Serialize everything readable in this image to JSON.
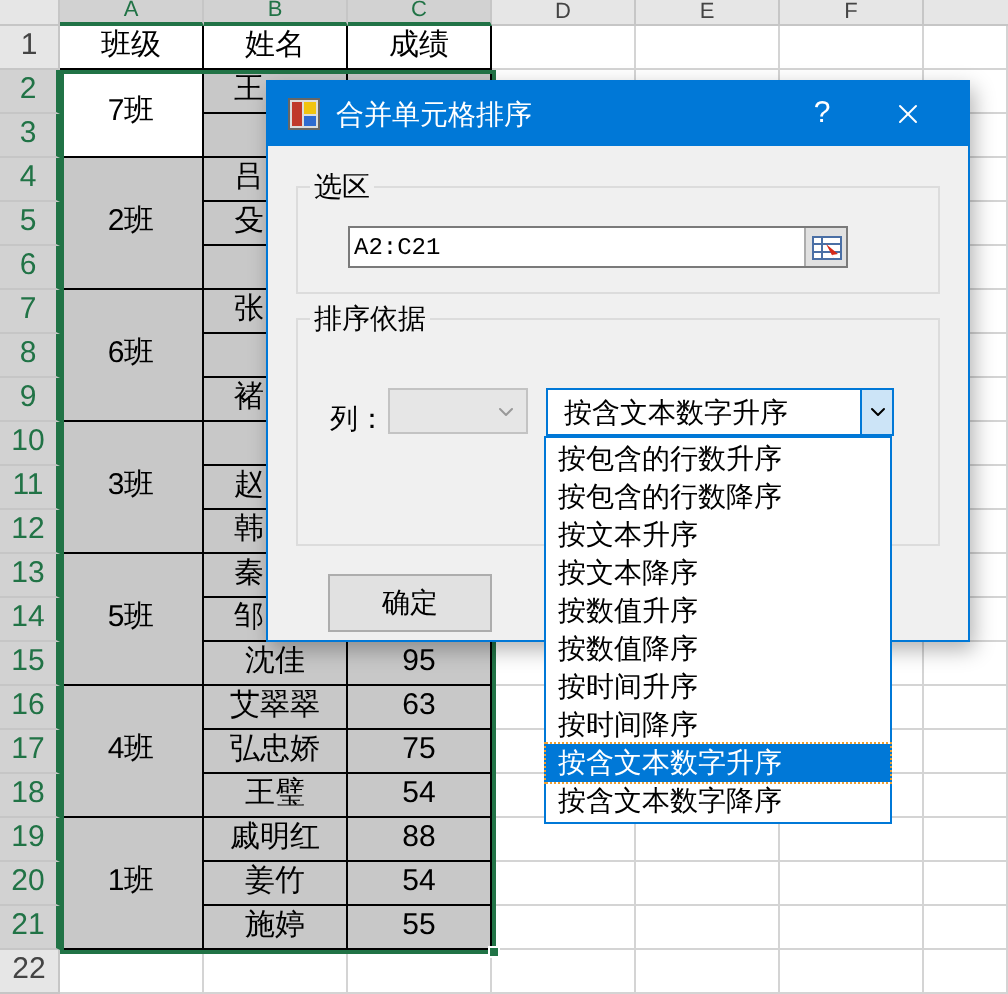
{
  "sheet": {
    "columns": [
      {
        "label": "A",
        "selected": true
      },
      {
        "label": "B",
        "selected": true
      },
      {
        "label": "C",
        "selected": true
      },
      {
        "label": "D",
        "selected": false
      },
      {
        "label": "E",
        "selected": false
      },
      {
        "label": "F",
        "selected": false
      }
    ],
    "rows": [
      {
        "label": "1",
        "selected": false,
        "kind": "header",
        "cells": [
          "班级",
          "姓名",
          "成绩"
        ]
      },
      {
        "label": "2",
        "selected": true,
        "kind": "data",
        "class": "7班",
        "shaded": false,
        "name": "王"
      },
      {
        "label": "3",
        "selected": true,
        "kind": "data"
      },
      {
        "label": "4",
        "selected": true,
        "kind": "data",
        "class": "2班",
        "shaded": true,
        "name": "吕"
      },
      {
        "label": "5",
        "selected": true,
        "kind": "data",
        "name": "殳"
      },
      {
        "label": "6",
        "selected": true,
        "kind": "data"
      },
      {
        "label": "7",
        "selected": true,
        "kind": "data",
        "class": "6班",
        "shaded": true,
        "name": "张"
      },
      {
        "label": "8",
        "selected": true,
        "kind": "data"
      },
      {
        "label": "9",
        "selected": true,
        "kind": "data",
        "name": "褚"
      },
      {
        "label": "10",
        "selected": true,
        "kind": "data",
        "class": "3班",
        "shaded": true
      },
      {
        "label": "11",
        "selected": true,
        "kind": "data",
        "name": "赵"
      },
      {
        "label": "12",
        "selected": true,
        "kind": "data",
        "name": "韩"
      },
      {
        "label": "13",
        "selected": true,
        "kind": "data",
        "class": "5班",
        "shaded": true,
        "name": "秦"
      },
      {
        "label": "14",
        "selected": true,
        "kind": "data",
        "name": "邹"
      },
      {
        "label": "15",
        "selected": true,
        "kind": "data",
        "name": "沈佳",
        "score": "95"
      },
      {
        "label": "16",
        "selected": true,
        "kind": "data",
        "class": "4班",
        "shaded": true,
        "name": "艾翠翠",
        "score": "63"
      },
      {
        "label": "17",
        "selected": true,
        "kind": "data",
        "name": "弘忠娇",
        "score": "75"
      },
      {
        "label": "18",
        "selected": true,
        "kind": "data",
        "name": "王璧",
        "score": "54"
      },
      {
        "label": "19",
        "selected": true,
        "kind": "data",
        "class": "1班",
        "shaded": true,
        "name": "戚明红",
        "score": "88"
      },
      {
        "label": "20",
        "selected": true,
        "kind": "data",
        "name": "姜竹",
        "score": "54"
      },
      {
        "label": "21",
        "selected": true,
        "kind": "data",
        "name": "施婷",
        "score": "55"
      },
      {
        "label": "22",
        "selected": false,
        "kind": "empty"
      }
    ]
  },
  "dialog": {
    "title": "合并单元格排序",
    "help": "?",
    "range_group": {
      "title": "选区",
      "value": "A2:C21"
    },
    "sort_group": {
      "title": "排序依据",
      "column_label": "列：",
      "column_disabled": true,
      "order_value": "按含文本数字升序",
      "options": [
        {
          "label": "按包含的行数升序",
          "selected": false
        },
        {
          "label": "按包含的行数降序",
          "selected": false
        },
        {
          "label": "按文本升序",
          "selected": false
        },
        {
          "label": "按文本降序",
          "selected": false
        },
        {
          "label": "按数值升序",
          "selected": false
        },
        {
          "label": "按数值降序",
          "selected": false
        },
        {
          "label": "按时间升序",
          "selected": false
        },
        {
          "label": "按时间降序",
          "selected": false
        },
        {
          "label": "按含文本数字升序",
          "selected": true
        },
        {
          "label": "按含文本数字降序",
          "selected": false
        }
      ]
    },
    "ok_button": "确定"
  }
}
